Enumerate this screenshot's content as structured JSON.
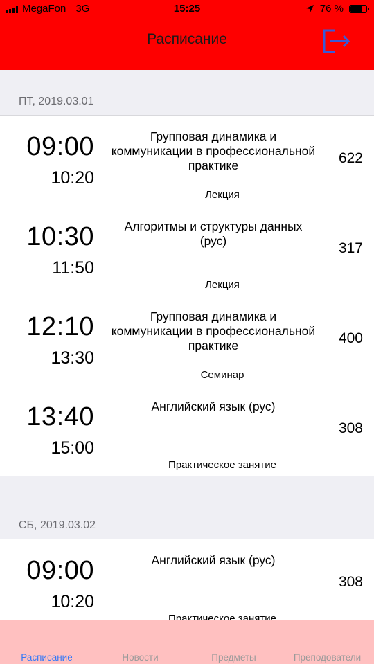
{
  "status_bar": {
    "carrier": "MegaFon",
    "network": "3G",
    "time": "15:25",
    "battery_percent": "76 %",
    "battery_level": 0.76
  },
  "nav": {
    "title": "Расписание",
    "logout_icon": "logout-icon"
  },
  "days": [
    {
      "label": "ПТ, 2019.03.01",
      "lessons": [
        {
          "start": "09:00",
          "end": "10:20",
          "subject": "Групповая динамика и коммуникации в профессиональной практике",
          "type": "Лекция",
          "room": "622"
        },
        {
          "start": "10:30",
          "end": "11:50",
          "subject": "Алгоритмы и структуры данных (рус)",
          "type": "Лекция",
          "room": "317"
        },
        {
          "start": "12:10",
          "end": "13:30",
          "subject": "Групповая динамика и коммуникации в профессиональной практике",
          "type": "Семинар",
          "room": "400"
        },
        {
          "start": "13:40",
          "end": "15:00",
          "subject": "Английский язык (рус)",
          "type": "Практическое занятие",
          "room": "308"
        }
      ]
    },
    {
      "label": "СБ, 2019.03.02",
      "lessons": [
        {
          "start": "09:00",
          "end": "10:20",
          "subject": "Английский язык (рус)",
          "type": "Практическое занятие",
          "room": "308"
        }
      ]
    }
  ],
  "tabs": [
    {
      "label": "Расписание",
      "active": true
    },
    {
      "label": "Новости",
      "active": false
    },
    {
      "label": "Предметы",
      "active": false
    },
    {
      "label": "Преподователи",
      "active": false
    }
  ],
  "colors": {
    "header": "#fe0000",
    "tab_bar": "#ffc0c0",
    "active_tab": "#3478f6",
    "icon": "#3a5ad8"
  }
}
